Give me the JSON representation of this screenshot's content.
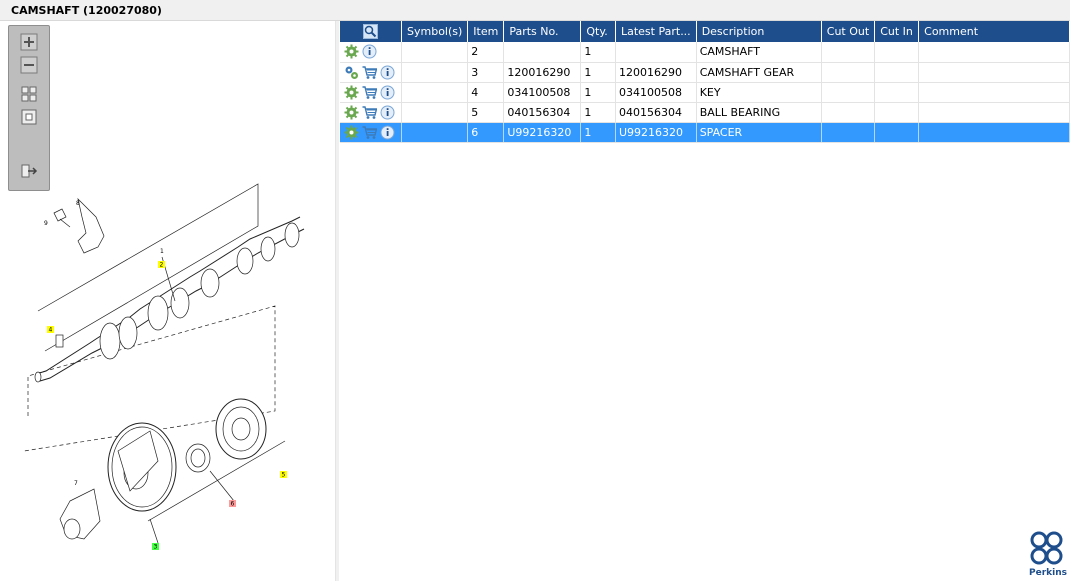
{
  "window": {
    "title": "CAMSHAFT (120027080)"
  },
  "zoom_toolbar": {
    "buttons": [
      {
        "icon": "zoom-in-icon"
      },
      {
        "icon": "zoom-out-icon"
      },
      {
        "icon": "fit-all-icon"
      },
      {
        "icon": "fit-window-icon"
      },
      {
        "icon": "export-icon"
      }
    ]
  },
  "grid": {
    "columns": [
      "",
      "Symbol(s)",
      "Item",
      "Parts No.",
      "Qty.",
      "Latest Part...",
      "Description",
      "Cut Out",
      "Cut In",
      "Comment"
    ],
    "rows": [
      {
        "icons": [
          "gear-icon",
          "info-icon"
        ],
        "symbols": "",
        "item": "2",
        "parts_no": "",
        "qty": "1",
        "latest": "",
        "description": "CAMSHAFT",
        "cut_out": "",
        "cut_in": "",
        "comment": ""
      },
      {
        "icons": [
          "gears-icon",
          "cart-icon",
          "info-icon"
        ],
        "symbols": "",
        "item": "3",
        "parts_no": "120016290",
        "qty": "1",
        "latest": "120016290",
        "description": "CAMSHAFT GEAR",
        "cut_out": "",
        "cut_in": "",
        "comment": ""
      },
      {
        "icons": [
          "gear-icon",
          "cart-icon",
          "info-icon"
        ],
        "symbols": "",
        "item": "4",
        "parts_no": "034100508",
        "qty": "1",
        "latest": "034100508",
        "description": "KEY",
        "cut_out": "",
        "cut_in": "",
        "comment": ""
      },
      {
        "icons": [
          "gear-icon",
          "cart-icon",
          "info-icon"
        ],
        "symbols": "",
        "item": "5",
        "parts_no": "040156304",
        "qty": "1",
        "latest": "040156304",
        "description": "BALL BEARING",
        "cut_out": "",
        "cut_in": "",
        "comment": ""
      },
      {
        "icons": [
          "gear-icon",
          "cart-icon",
          "info-icon"
        ],
        "symbols": "",
        "item": "6",
        "parts_no": "U99216320",
        "qty": "1",
        "latest": "U99216320",
        "description": "SPACER",
        "cut_out": "",
        "cut_in": "",
        "comment": "",
        "selected": true
      }
    ]
  },
  "drawing": {
    "callouts": [
      "1",
      "2",
      "3",
      "4",
      "5",
      "6",
      "7",
      "8",
      "9"
    ]
  },
  "brand": {
    "name": "Perkins",
    "color": "#1e4e8c"
  },
  "colors": {
    "header": "#1e4e8c",
    "selection": "#3399ff",
    "gear": "#6aa84f",
    "cart": "#3d7ab8"
  }
}
